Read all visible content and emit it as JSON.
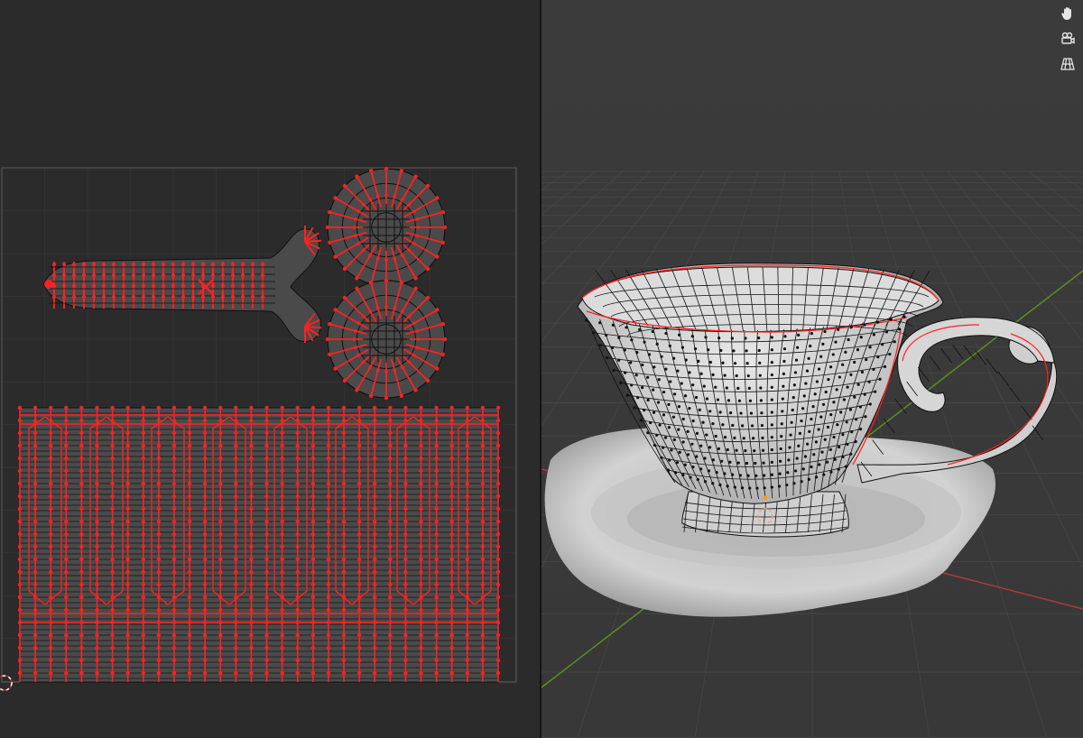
{
  "editors": {
    "uv_editor": {
      "icons": [
        "2d-cursor-icon",
        "uv-pivot-icon"
      ]
    },
    "viewport_3d": {
      "navigation_tools": [
        {
          "name": "pan-hand-icon"
        },
        {
          "name": "camera-view-icon"
        },
        {
          "name": "perspective-grid-icon"
        }
      ]
    }
  },
  "colors": {
    "uv_background": "#2b2b2b",
    "viewport_background": "#3a3a3a",
    "uv_face_fill": "#4a4a4a",
    "wire": "#111111",
    "seam": "#ff2020",
    "axis_x": "#b03a3a",
    "axis_y": "#5a8f1f",
    "mesh_light": "#d8d8d8",
    "saucer": "#c9c9c9"
  }
}
